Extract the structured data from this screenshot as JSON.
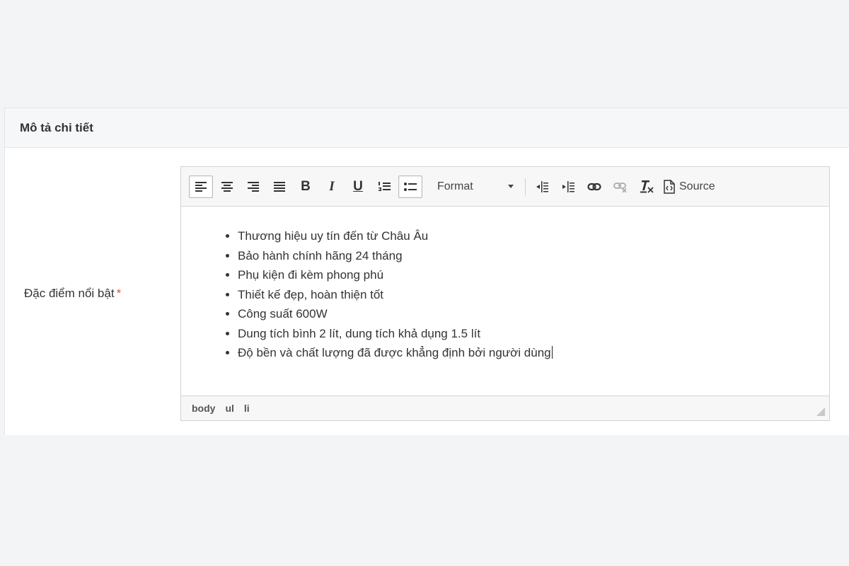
{
  "panel": {
    "title": "Mô tả chi tiết"
  },
  "field": {
    "label": "Đặc điểm nổi bật",
    "required_mark": "*"
  },
  "toolbar": {
    "buttons": [
      {
        "name": "align-left-icon",
        "active": true
      },
      {
        "name": "align-center-icon",
        "active": false
      },
      {
        "name": "align-right-icon",
        "active": false
      },
      {
        "name": "align-justify-icon",
        "active": false
      },
      {
        "name": "bold-icon",
        "glyph": "B"
      },
      {
        "name": "italic-icon",
        "glyph": "I"
      },
      {
        "name": "underline-icon",
        "glyph": "U"
      },
      {
        "name": "numbered-list-icon",
        "active": false
      },
      {
        "name": "bulleted-list-icon",
        "active": true
      }
    ],
    "format_label": "Format",
    "indent_buttons": [
      "decrease-indent-icon",
      "increase-indent-icon"
    ],
    "link_icon": "link-icon",
    "unlink_icon": "unlink-icon",
    "remove_format_icon": "remove-format-icon",
    "source_label": "Source"
  },
  "content": {
    "items": [
      "Thương hiệu uy tín đến từ Châu Âu",
      "Bảo hành chính hãng 24 tháng",
      "Phụ kiện đi kèm phong phú",
      "Thiết kế đẹp, hoàn thiện tốt",
      "Công suất 600W",
      "Dung tích bình 2 lít, dung tích khả dụng 1.5 lít",
      "Độ bền và chất lượng đã được khẳng định bởi người dùng"
    ]
  },
  "statusbar": {
    "path": [
      "body",
      "ul",
      "li"
    ]
  },
  "colors": {
    "required": "#d9534f",
    "page_background": "#f3f4f6"
  }
}
